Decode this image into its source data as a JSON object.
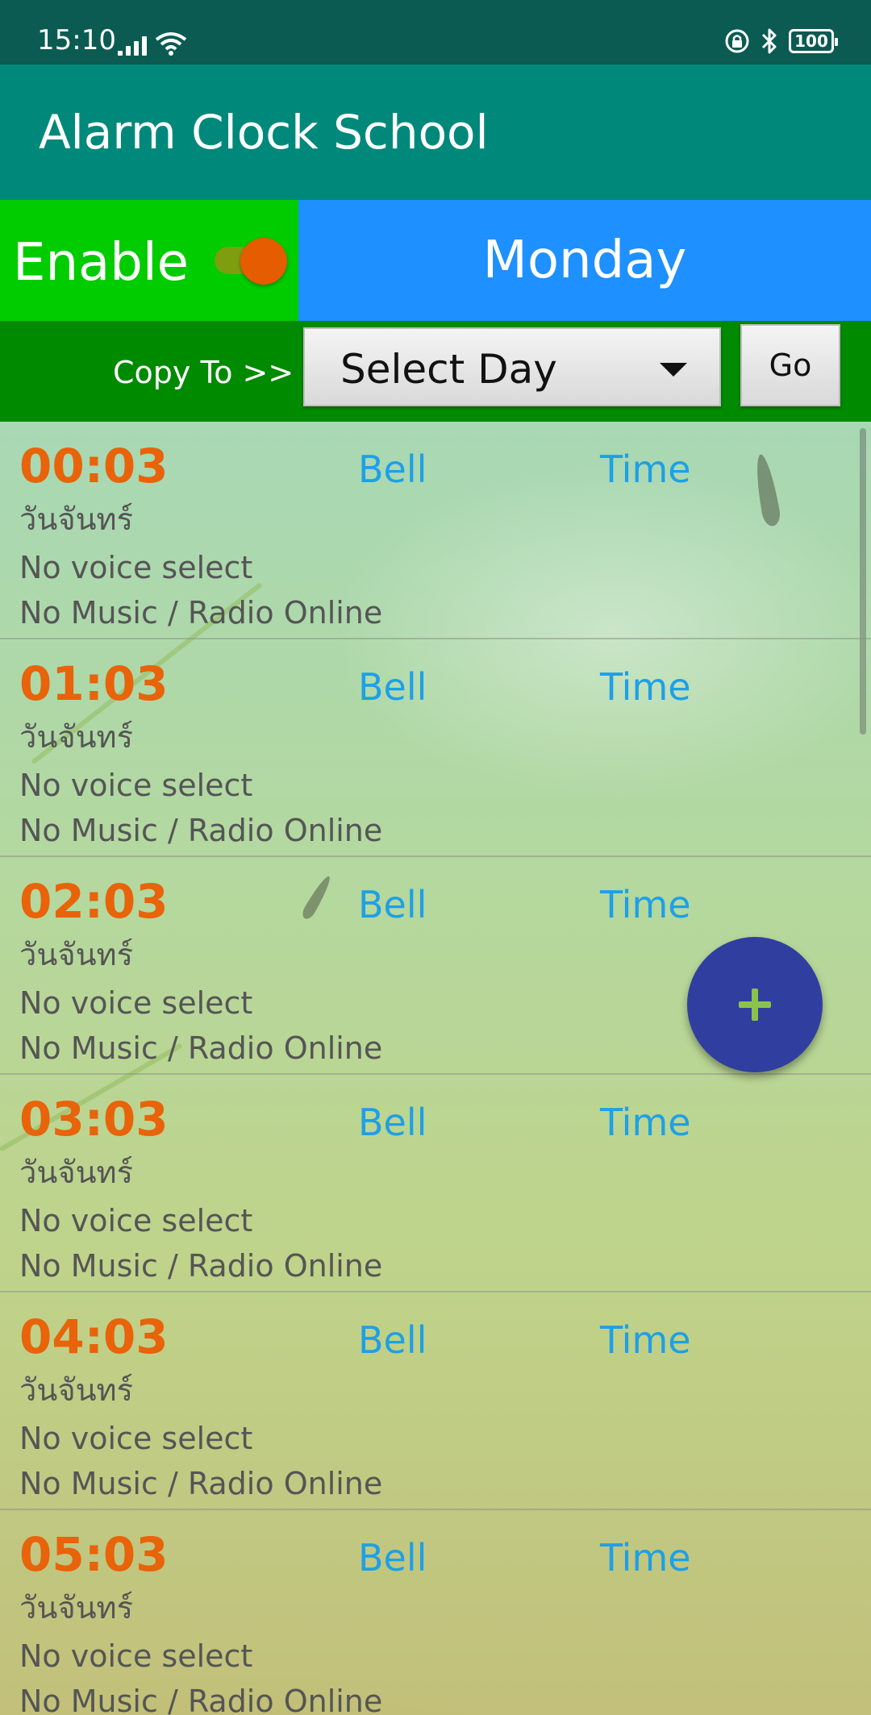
{
  "status_bar": {
    "time": "15:10",
    "battery": "100"
  },
  "app_bar": {
    "title": "Alarm Clock School"
  },
  "enable": {
    "label": "Enable",
    "on": true
  },
  "day": {
    "label": "Monday"
  },
  "copy": {
    "label": "Copy To >>",
    "select_value": "Select Day",
    "go_label": "Go"
  },
  "colors": {
    "status_bar": "#0b5b52",
    "app_bar": "#00897b",
    "enable_bg": "#00cc00",
    "day_bg": "#1e90ff",
    "copy_bg": "#008a00",
    "time_color": "#e8630a",
    "link_color": "#1ea0e6",
    "fab": "#303f9f",
    "fab_icon": "#8bc34a"
  },
  "alarms": [
    {
      "time": "00:03",
      "bell": "Bell",
      "time_label": "Time",
      "day": "วันจันทร์",
      "voice": "No voice select",
      "music": "No Music / Radio Online"
    },
    {
      "time": "01:03",
      "bell": "Bell",
      "time_label": "Time",
      "day": "วันจันทร์",
      "voice": "No voice select",
      "music": "No Music / Radio Online"
    },
    {
      "time": "02:03",
      "bell": "Bell",
      "time_label": "Time",
      "day": "วันจันทร์",
      "voice": "No voice select",
      "music": "No Music / Radio Online"
    },
    {
      "time": "03:03",
      "bell": "Bell",
      "time_label": "Time",
      "day": "วันจันทร์",
      "voice": "No voice select",
      "music": "No Music / Radio Online"
    },
    {
      "time": "04:03",
      "bell": "Bell",
      "time_label": "Time",
      "day": "วันจันทร์",
      "voice": "No voice select",
      "music": "No Music / Radio Online"
    },
    {
      "time": "05:03",
      "bell": "Bell",
      "time_label": "Time",
      "day": "วันจันทร์",
      "voice": "No voice select",
      "music": "No Music / Radio Online"
    }
  ],
  "fab": {
    "icon": "plus-icon"
  }
}
